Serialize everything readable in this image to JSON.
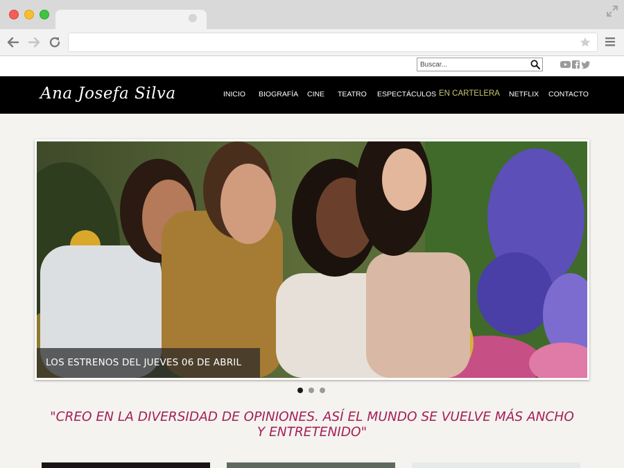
{
  "browser": {
    "url": ""
  },
  "site": {
    "logo": "Ana Josefa Silva",
    "search": {
      "placeholder": "Buscar..."
    },
    "social": [
      "youtube-icon",
      "facebook-icon",
      "twitter-icon"
    ],
    "nav": [
      {
        "label": "INICIO",
        "active": false
      },
      {
        "label": "BIOGRAFÍA",
        "active": false
      },
      {
        "label": "CINE",
        "active": false
      },
      {
        "label": "TEATRO",
        "active": false
      },
      {
        "label": "ESPECTÁCULOS",
        "active": false
      },
      {
        "label": "EN CARTELERA",
        "active": true
      },
      {
        "label": "NETFLIX",
        "active": false
      },
      {
        "label": "CONTACTO",
        "active": false
      }
    ],
    "slider": {
      "caption": "LOS ESTRENOS DEL JUEVES 06 DE ABRIL",
      "slide_count": 3,
      "active_slide": 1
    },
    "quote": "\"CREO EN LA DIVERSIDAD DE OPINIONES. ASÍ EL MUNDO SE VUELVE MÁS ANCHO Y ENTRETENIDO\""
  },
  "colors": {
    "accent": "#a41f57",
    "nav_active": "#c5c772",
    "nav_bg": "#000000",
    "page_bg": "#f4f3ef"
  }
}
